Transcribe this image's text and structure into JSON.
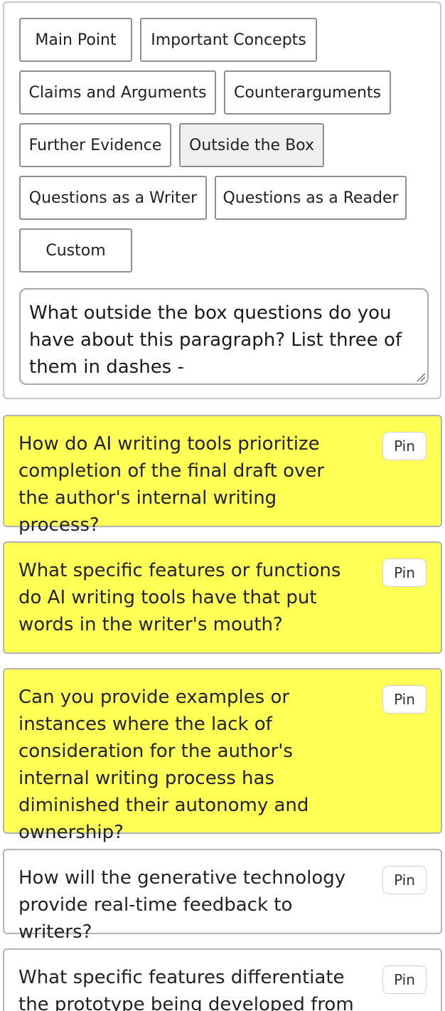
{
  "prompt_types": [
    {
      "label": "Main Point",
      "selected": false
    },
    {
      "label": "Important Concepts",
      "selected": false
    },
    {
      "label": "Claims and Arguments",
      "selected": false
    },
    {
      "label": "Counterarguments",
      "selected": false
    },
    {
      "label": "Further Evidence",
      "selected": false
    },
    {
      "label": "Outside the Box",
      "selected": true
    },
    {
      "label": "Questions as a Writer",
      "selected": false
    },
    {
      "label": "Questions as a Reader",
      "selected": false
    },
    {
      "label": "Custom",
      "selected": false
    }
  ],
  "prompt": {
    "value": "What outside the box questions do you have about this paragraph? List three of them in dashes -"
  },
  "colors": {
    "highlight": "#ffff55",
    "selected_chip": "#efefef"
  },
  "results": [
    {
      "text": "How do AI writing tools prioritize completion of the final draft over the author's internal writing process?",
      "highlighted": true,
      "pin_label": "Pin"
    },
    {
      "text": "What specific features or functions do AI writing tools have that put words in the writer's mouth?",
      "highlighted": true,
      "pin_label": "Pin"
    },
    {
      "text": "Can you provide examples or instances where the lack of consideration for the author's internal writing process has diminished their autonomy and ownership?",
      "highlighted": true,
      "pin_label": "Pin"
    },
    {
      "text": "How will the generative technology provide real-time feedback to writers?",
      "highlighted": false,
      "pin_label": "Pin"
    },
    {
      "text": "What specific features differentiate the prototype being developed from the",
      "highlighted": false,
      "pin_label": "Pin"
    }
  ]
}
